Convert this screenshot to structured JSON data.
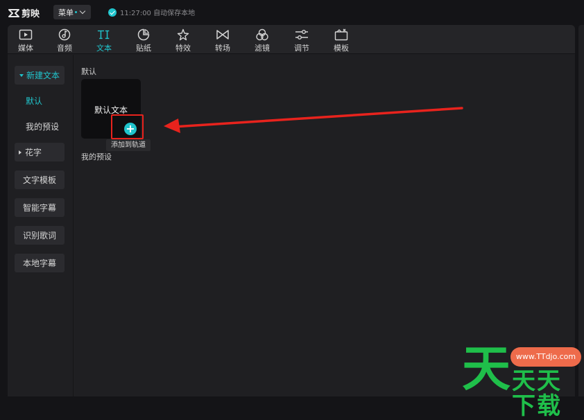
{
  "app": {
    "logo_text": "剪映",
    "menu_label": "菜单",
    "save_status": "11:27:00 自动保存本地"
  },
  "tabs": [
    {
      "label": "媒体",
      "icon": "media-icon"
    },
    {
      "label": "音频",
      "icon": "audio-icon"
    },
    {
      "label": "文本",
      "icon": "text-icon",
      "active": true
    },
    {
      "label": "贴纸",
      "icon": "sticker-icon"
    },
    {
      "label": "特效",
      "icon": "effects-icon"
    },
    {
      "label": "转场",
      "icon": "transition-icon"
    },
    {
      "label": "滤镜",
      "icon": "filter-icon"
    },
    {
      "label": "调节",
      "icon": "adjust-icon"
    },
    {
      "label": "模板",
      "icon": "template-icon"
    }
  ],
  "sidebar": {
    "items": [
      {
        "label": "新建文本"
      },
      {
        "label": "默认"
      },
      {
        "label": "我的预设"
      },
      {
        "label": "花字"
      },
      {
        "label": "文字模板"
      },
      {
        "label": "智能字幕"
      },
      {
        "label": "识别歌词"
      },
      {
        "label": "本地字幕"
      }
    ]
  },
  "content": {
    "default_label": "默认",
    "card_text": "默认文本",
    "add_symbol": "+",
    "tooltip": "添加到轨道",
    "my_presets_label": "我的预设"
  },
  "watermark": {
    "big_char": "天",
    "url": "www.TTdjo.com",
    "name": "天天下载"
  },
  "colors": {
    "accent": "#20c4cc",
    "highlight": "#e8231d",
    "watermark_green": "#1fbf4a",
    "watermark_badge": "#ee6b4b"
  }
}
